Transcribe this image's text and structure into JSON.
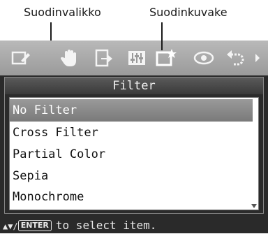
{
  "callouts": {
    "left": "Suodinvalikko",
    "right": "Suodinkuvake"
  },
  "toolbar": {
    "icons": [
      "pencil-icon",
      "hand-icon",
      "export-icon",
      "adjust-icon",
      "filter-icon",
      "eye-icon",
      "undo-icon",
      "more-arrow-icon"
    ],
    "selected": "filter-icon"
  },
  "filter_menu": {
    "title": "Filter",
    "items": [
      {
        "label": "No Filter",
        "selected": true
      },
      {
        "label": "Cross Filter",
        "selected": false
      },
      {
        "label": "Partial Color",
        "selected": false
      },
      {
        "label": "Sepia",
        "selected": false
      },
      {
        "label": "Monochrome",
        "selected": false
      }
    ]
  },
  "hint": {
    "arrows": "▲▼/",
    "enter_key": "ENTER",
    "text": "to select item."
  },
  "colors": {
    "screen_bg": "#2a2a2a",
    "highlight": "#8a8a8a",
    "list_bg": "#ffffff"
  }
}
